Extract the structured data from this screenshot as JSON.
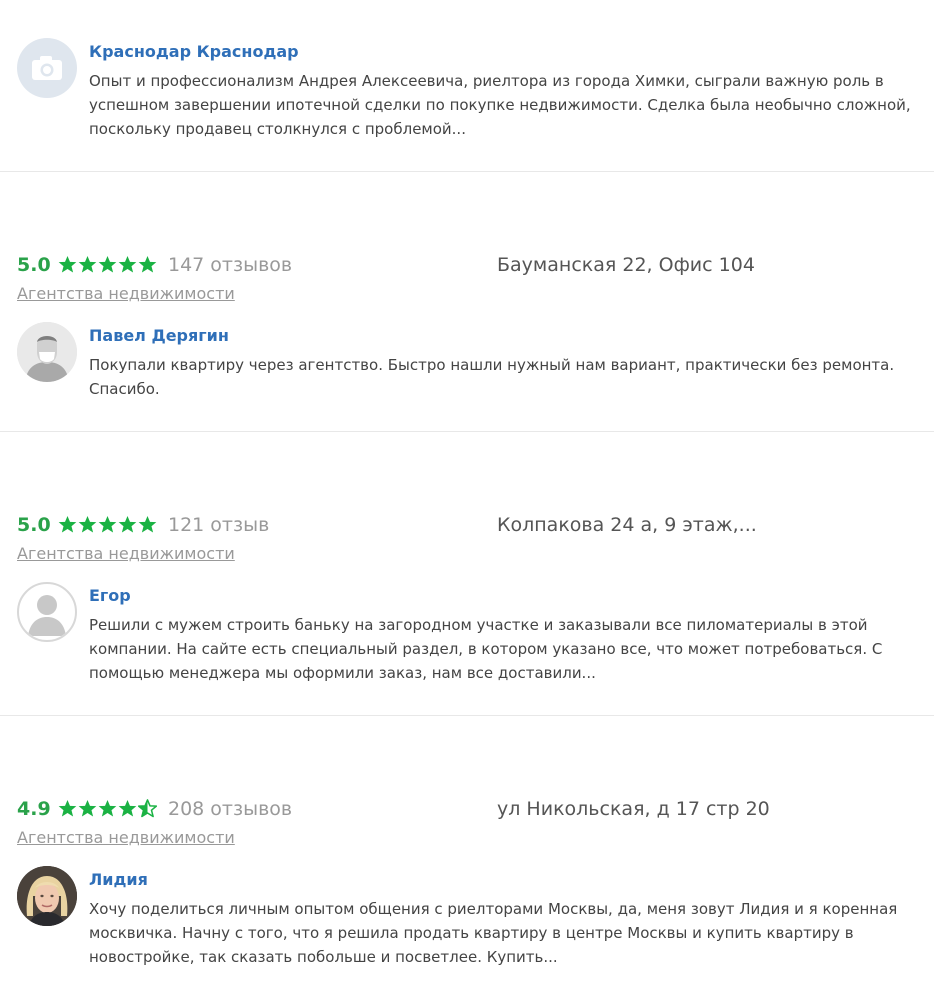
{
  "colors": {
    "author_link": "#2f6fb8",
    "rating_green": "#2aa24a",
    "star_green": "#1ab243",
    "muted_text": "#999999",
    "divider": "#e8e8e8"
  },
  "top_review": {
    "avatar_icon": "camera-icon",
    "author": "Краснодар Краснодар",
    "text": "Опыт и профессионализм Андрея Алексеевича, риелтора из города Химки, сыграли важную роль в успешном завершении ипотечной сделки по покупке недвижимости. Сделка была необычно сложной, поскольку продавец столкнулся с проблемой..."
  },
  "agencies": [
    {
      "rating": "5.0",
      "stars": 5,
      "reviews_count": "147 отзывов",
      "address": "Бауманская 22, Офис 104",
      "category": "Агентства недвижимости",
      "review": {
        "avatar_icon": "masked-person-avatar",
        "author": "Павел Дерягин",
        "text": "Покупали квартиру через агентство. Быстро нашли нужный нам вариант, практически без ремонта. Спасибо."
      }
    },
    {
      "rating": "5.0",
      "stars": 5,
      "reviews_count": "121 отзыв",
      "address": "Колпакова 24 а, 9 этаж,...",
      "category": "Агентства недвижимости",
      "review": {
        "avatar_icon": "person-placeholder-icon",
        "author": "Егор",
        "text": "Решили с мужем строить баньку на загородном участке и заказывали все пиломатериалы в этой компании. На сайте есть специальный раздел, в котором указано все, что может потребоваться. С помощью менеджера мы оформили заказ, нам все доставили..."
      }
    },
    {
      "rating": "4.9",
      "stars": 4.5,
      "reviews_count": "208 отзывов",
      "address": "ул Никольская, д 17 стр 20",
      "category": "Агентства недвижимости",
      "review": {
        "avatar_icon": "woman-photo-avatar",
        "author": "Лидия",
        "text": "Хочу поделиться личным опытом общения с риелторами Москвы, да, меня зовут Лидия и я коренная москвичка. Начну с того, что я решила продать квартиру в центре Москвы и купить квартиру в новостройке, так сказать побольше и посветлее. Купить..."
      }
    }
  ]
}
